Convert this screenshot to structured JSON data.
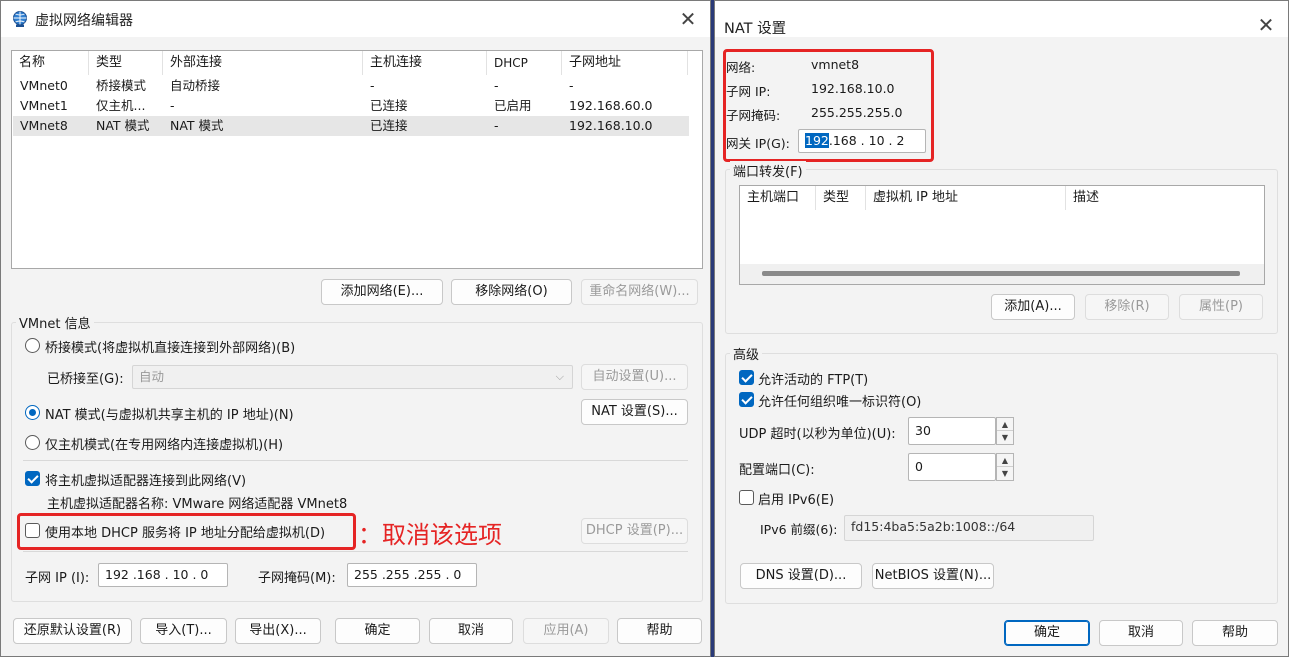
{
  "left_window": {
    "title": "虚拟网络编辑器",
    "table": {
      "headers": [
        "名称",
        "类型",
        "外部连接",
        "主机连接",
        "DHCP",
        "子网地址"
      ],
      "rows": [
        [
          "VMnet0",
          "桥接模式",
          "自动桥接",
          "-",
          "-",
          "-"
        ],
        [
          "VMnet1",
          "仅主机...",
          "-",
          "已连接",
          "已启用",
          "192.168.60.0"
        ],
        [
          "VMnet8",
          "NAT 模式",
          "NAT 模式",
          "已连接",
          "-",
          "192.168.10.0"
        ]
      ]
    },
    "buttons": {
      "add_network": "添加网络(E)...",
      "remove_network": "移除网络(O)",
      "rename_network": "重命名网络(W)..."
    },
    "vmnet_info": {
      "group_label": "VMnet 信息",
      "bridged_radio": "桥接模式(将虚拟机直接连接到外部网络)(B)",
      "bridged_to_label": "已桥接至(G):",
      "bridged_to_value": "自动",
      "auto_settings": "自动设置(U)...",
      "nat_radio": "NAT 模式(与虚拟机共享主机的 IP 地址)(N)",
      "nat_settings": "NAT 设置(S)...",
      "host_only_radio": "仅主机模式(在专用网络内连接虚拟机)(H)",
      "connect_adapter_check": "将主机虚拟适配器连接到此网络(V)",
      "adapter_name": "主机虚拟适配器名称: VMware 网络适配器 VMnet8",
      "dhcp_check": "使用本地 DHCP 服务将 IP 地址分配给虚拟机(D)",
      "dhcp_settings": "DHCP 设置(P)...",
      "annotation": "：取消该选项",
      "subnet_ip_label": "子网 IP (I):",
      "subnet_ip_value": "192 .168 . 10  .  0",
      "subnet_mask_label": "子网掩码(M):",
      "subnet_mask_value": "255 .255 .255 .  0"
    },
    "bottom": {
      "restore": "还原默认设置(R)",
      "import": "导入(T)...",
      "export": "导出(X)...",
      "ok": "确定",
      "cancel": "取消",
      "apply": "应用(A)",
      "help": "帮助"
    }
  },
  "right_window": {
    "title": "NAT 设置",
    "network_label": "网络:",
    "network_value": "vmnet8",
    "subnet_ip_label": "子网 IP:",
    "subnet_ip_value": "192.168.10.0",
    "subnet_mask_label": "子网掩码:",
    "subnet_mask_value": "255.255.255.0",
    "gateway_label": "网关 IP(G):",
    "gateway_sel": "192",
    "gateway_rest": ".168 . 10  .  2",
    "port_forward_label": "端口转发(F)",
    "port_headers": [
      "主机端口",
      "类型",
      "虚拟机 IP 地址",
      "描述"
    ],
    "port_buttons": {
      "add": "添加(A)...",
      "remove": "移除(R)",
      "properties": "属性(P)"
    },
    "advanced_label": "高级",
    "allow_ftp": "允许活动的 FTP(T)",
    "allow_oui": "允许任何组织唯一标识符(O)",
    "udp_timeout_label": "UDP 超时(以秒为单位)(U):",
    "udp_timeout_value": "30",
    "config_port_label": "配置端口(C):",
    "config_port_value": "0",
    "enable_ipv6": "启用 IPv6(E)",
    "ipv6_prefix_label": "IPv6 前缀(6):",
    "ipv6_prefix_value": "fd15:4ba5:5a2b:1008::/64",
    "dns_settings": "DNS 设置(D)...",
    "netbios_settings": "NetBIOS 设置(N)...",
    "ok": "确定",
    "cancel": "取消",
    "help": "帮助"
  }
}
